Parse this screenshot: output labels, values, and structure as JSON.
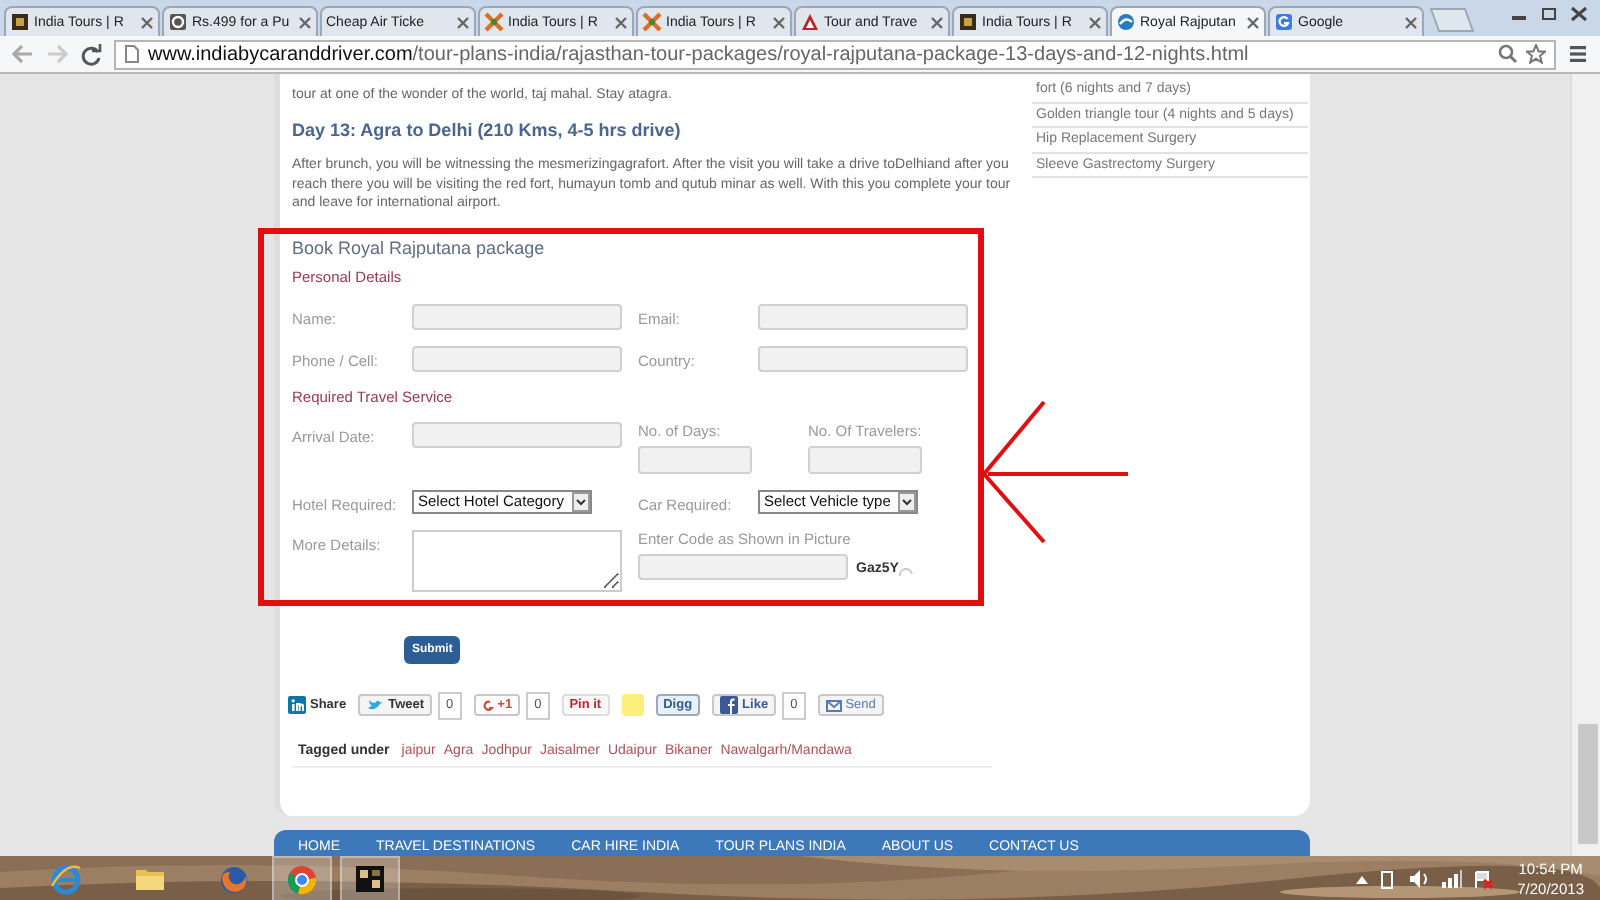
{
  "browser": {
    "tabs": [
      {
        "label": "India Tours | R",
        "kind": "dark",
        "selected": false
      },
      {
        "label": "Rs.499 for a Pu",
        "kind": "coupon",
        "selected": false
      },
      {
        "label": "Cheap Air Ticke",
        "kind": "plain",
        "selected": false
      },
      {
        "label": "India Tours | R",
        "kind": "cross",
        "selected": false
      },
      {
        "label": "India Tours | R",
        "kind": "cross",
        "selected": false
      },
      {
        "label": "Tour and Trave",
        "kind": "peak",
        "selected": false
      },
      {
        "label": "India Tours | R",
        "kind": "dark",
        "selected": false
      },
      {
        "label": "Royal Rajputan",
        "kind": "swirl",
        "selected": true
      },
      {
        "label": "Google",
        "kind": "google",
        "selected": false
      }
    ],
    "address": {
      "host": "www.indiabycaranddriver.com",
      "path": "/tour-plans-india/rajasthan-tour-packages/royal-rajputana-package-13-days-and-12-nights.html"
    }
  },
  "article": {
    "intro": "tour at one of the wonder of the world, taj mahal. Stay atagra.",
    "heading": "Day 13: Agra to Delhi (210 Kms, 4-5 hrs drive)",
    "paragraph": "After brunch, you will be witnessing the mesmerizingagrafort. After the visit you will take a drive toDelhiand after you reach there you will be visiting the red fort, humayun tomb and qutub minar as well. With this you complete your tour and leave for international airport."
  },
  "form": {
    "title": "Book Royal Rajputana package",
    "sections": [
      {
        "title": "Personal Details",
        "rows": [
          [
            {
              "kind": "text",
              "label": "Name:"
            },
            {
              "kind": "text",
              "label": "Email:"
            }
          ],
          [
            {
              "kind": "text",
              "label": "Phone / Cell:"
            },
            {
              "kind": "text",
              "label": "Country:"
            }
          ]
        ]
      },
      {
        "title": "Required Travel Service",
        "rows": [
          [
            {
              "kind": "text",
              "label": "Arrival Date:"
            },
            {
              "kind": "stacked",
              "label": "No. of Days:"
            },
            {
              "kind": "stacked",
              "label": "No. Of Travelers:"
            }
          ],
          [
            {
              "kind": "select",
              "label": "Hotel Required:",
              "value": "Select Hotel Category"
            },
            {
              "kind": "select",
              "label": "Car Required:",
              "value": "Select Vehicle type"
            }
          ],
          [
            {
              "kind": "textarea",
              "label": "More Details:"
            },
            {
              "kind": "captcha",
              "label": "Enter Code as Shown in Picture",
              "code": "Gaz5Y"
            }
          ]
        ]
      }
    ],
    "submit": "Submit"
  },
  "share": [
    {
      "kind": "linkedin",
      "label": "Share"
    },
    {
      "kind": "twitter",
      "label": "Tweet",
      "count": "0"
    },
    {
      "kind": "gplus",
      "label": "+1",
      "count": "0"
    },
    {
      "kind": "pinterest",
      "label": "Pin it"
    },
    {
      "kind": "blank"
    },
    {
      "kind": "digg",
      "label": "Digg"
    },
    {
      "kind": "facebook",
      "label": "Like",
      "count": "0"
    },
    {
      "kind": "send",
      "label": "Send"
    }
  ],
  "tags": {
    "label": "Tagged under",
    "items": [
      "jaipur",
      "Agra",
      "Jodhpur",
      "Jaisalmer",
      "Udaipur",
      "Bikaner",
      "Nawalgarh/Mandawa"
    ]
  },
  "sidebar": {
    "items": [
      "fort (6 nights and 7 days)",
      "Golden triangle tour (4 nights and 5 days)",
      "Hip Replacement Surgery",
      "Sleeve Gastrectomy Surgery"
    ]
  },
  "nav": [
    "HOME",
    "TRAVEL DESTINATIONS",
    "CAR HIRE INDIA",
    "TOUR PLANS INDIA",
    "ABOUT US",
    "CONTACT US"
  ],
  "taskbar": {
    "apps": [
      {
        "kind": "ie",
        "open": false
      },
      {
        "kind": "folder",
        "open": false
      },
      {
        "kind": "firefox",
        "open": false
      },
      {
        "kind": "chrome",
        "open": true
      },
      {
        "kind": "film",
        "open": true
      }
    ],
    "time": "10:54 PM",
    "date": "7/20/2013"
  }
}
